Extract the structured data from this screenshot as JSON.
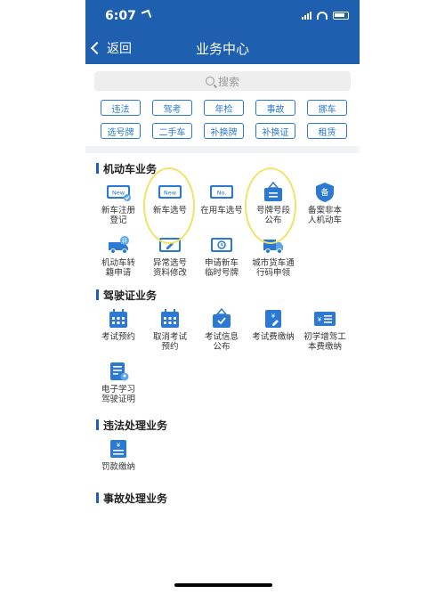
{
  "status_bar": {
    "time": "6:07"
  },
  "nav": {
    "back_label": "返回",
    "title": "业务中心"
  },
  "search": {
    "placeholder": "搜索"
  },
  "quick_chips": [
    "违法",
    "驾考",
    "年检",
    "事故",
    "挪车",
    "选号牌",
    "二手车",
    "补换牌",
    "补换证",
    "租赁"
  ],
  "sections": [
    {
      "title": "机动车业务",
      "items": [
        {
          "label": "新车注册\n登记",
          "icon": "new-car-registration-icon"
        },
        {
          "label": "新车选号",
          "icon": "new-plate-select-icon"
        },
        {
          "label": "在用车选号",
          "icon": "in-use-plate-select-icon"
        },
        {
          "label": "号牌号段\n公布",
          "icon": "plate-range-notice-icon"
        },
        {
          "label": "备案非本\n人机动车",
          "icon": "record-badge-icon"
        },
        {
          "label": "机动车转\n籍申请",
          "icon": "truck-transfer-icon"
        },
        {
          "label": "异常选号\n资料修改",
          "icon": "edit-document-icon"
        },
        {
          "label": "申请新车\n临时号牌",
          "icon": "temporary-plate-icon"
        },
        {
          "label": "城市货车通\n行码申领",
          "icon": "truck-pass-icon"
        }
      ]
    },
    {
      "title": "驾驶证业务",
      "items": [
        {
          "label": "考试预约",
          "icon": "calendar-icon"
        },
        {
          "label": "取消考试\n预约",
          "icon": "calendar-cancel-icon"
        },
        {
          "label": "考试信息\n公布",
          "icon": "exam-info-icon"
        },
        {
          "label": "考试费缴纳",
          "icon": "exam-fee-icon"
        },
        {
          "label": "初学增驾工\n本费缴纳",
          "icon": "fee-list-icon"
        },
        {
          "label": "电子学习\n驾驶证明",
          "icon": "e-learning-certificate-icon"
        }
      ]
    },
    {
      "title": "违法处理业务",
      "items": [
        {
          "label": "罚款缴纳",
          "icon": "fine-payment-icon"
        }
      ]
    },
    {
      "title": "事故处理业务",
      "items": []
    }
  ],
  "colors": {
    "brand": "#1e5fb0",
    "accent": "#2b79d3",
    "highlight": "#f3e264"
  }
}
